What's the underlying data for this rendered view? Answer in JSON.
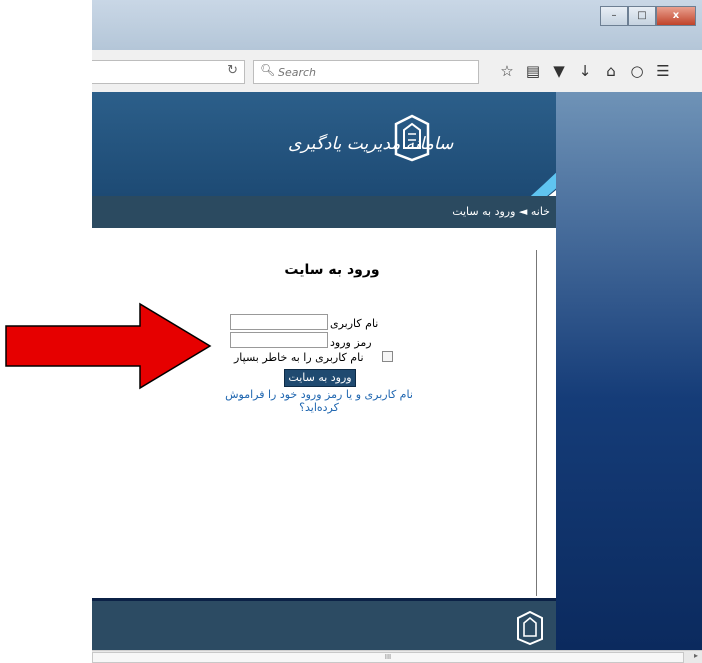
{
  "browser": {
    "window_buttons": [
      "–",
      "□",
      "x"
    ],
    "search_placeholder": "Search",
    "reload_icon": "reload-icon",
    "toolbar_icons": [
      "star-icon",
      "reading-list-icon",
      "pocket-icon",
      "download-icon",
      "home-icon",
      "chat-icon",
      "menu-icon"
    ]
  },
  "banner": {
    "logo_text": "سامانه مدیریت یادگیری"
  },
  "breadcrumb": {
    "home": "خانه",
    "separator": "◄",
    "current": "ورود به سایت"
  },
  "login": {
    "title": "ورود به سایت",
    "username_label": "نام کاربری",
    "password_label": "رمز ورود",
    "remember_label": "نام کاربری را به خاطر بسپار",
    "submit_label": "ورود به سایت",
    "forgot_link": "نام کاربری و یا رمز ورود خود را فراموش کرده‌اید؟"
  },
  "scrollbar": {
    "thumb_grip": "III"
  },
  "colors": {
    "accent": "#1f4a70",
    "link": "#1f66b0",
    "annotation_arrow": "#e60000"
  }
}
